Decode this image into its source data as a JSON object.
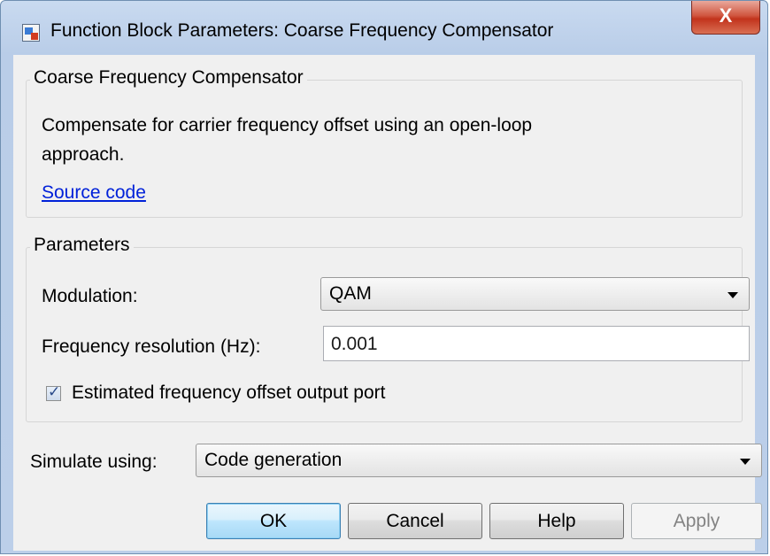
{
  "window": {
    "title": "Function Block Parameters: Coarse Frequency Compensator",
    "close_glyph": "X"
  },
  "description_group": {
    "title": "Coarse Frequency Compensator",
    "text_line1": "Compensate for carrier frequency offset using an open-loop",
    "text_line2": "approach.",
    "link": "Source code"
  },
  "parameters_group": {
    "title": "Parameters",
    "modulation_label": "Modulation:",
    "modulation_value": "QAM",
    "frequency_label": "Frequency resolution (Hz):",
    "frequency_value": "0.001",
    "checkbox_label": "Estimated frequency offset output port",
    "checkbox_checked": true
  },
  "simulate": {
    "label": "Simulate using:",
    "value": "Code generation"
  },
  "buttons": {
    "ok": "OK",
    "cancel": "Cancel",
    "help": "Help",
    "apply": "Apply"
  }
}
